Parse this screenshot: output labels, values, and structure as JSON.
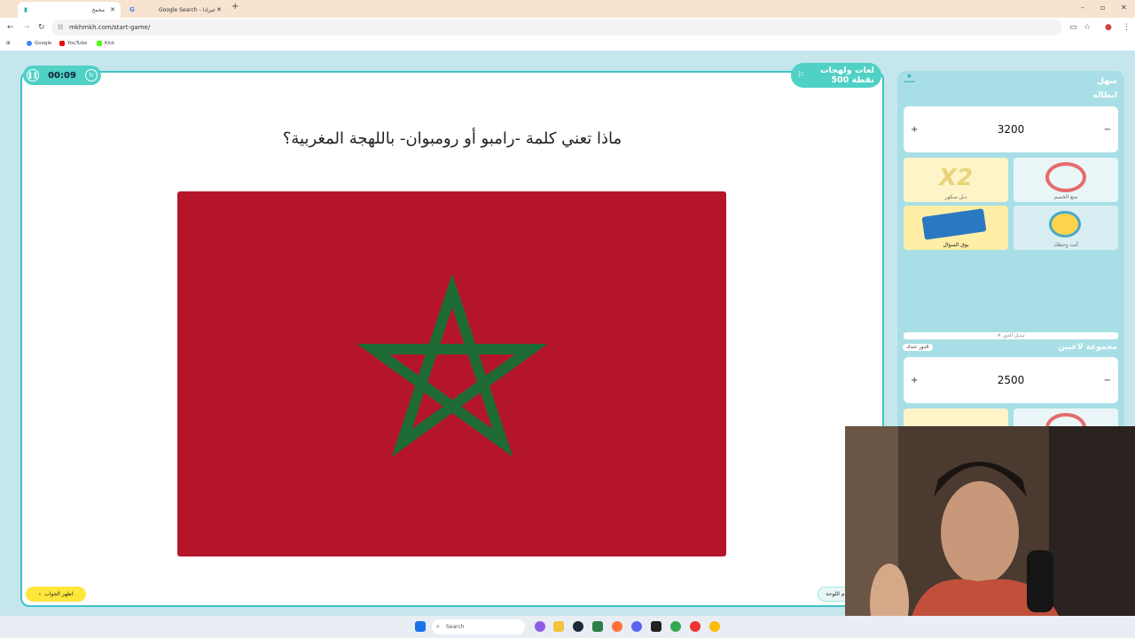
{
  "browser": {
    "tabs": [
      {
        "title": "مخمخ",
        "active": true
      },
      {
        "title": "Google Search - عيرادا",
        "active": false
      }
    ],
    "url": "mkhmkh.com/start-game/",
    "bookmarks": [
      "Google",
      "YouTube",
      "Kick"
    ]
  },
  "game": {
    "timer": "00:09",
    "category": {
      "name": "لغات ولهجات",
      "points": "500 نقطة"
    },
    "question": "ماذا تعني كلمة -رامبو أو رومبوان- باللهجة المغربية؟",
    "show_answer_label": "اظهر الجواب",
    "board_label": "م اللوحة",
    "image_colors": {
      "background": "#b5152b",
      "star": "#1f6b35"
    }
  },
  "sidebar": {
    "mini_label": "صفحة",
    "team1": {
      "label": "سهل",
      "name": "ابطاله",
      "score": "3200"
    },
    "powerups": [
      {
        "id": "x2",
        "text": "X2",
        "label": "دبل سكور"
      },
      {
        "id": "block",
        "label": "منع الخصم"
      },
      {
        "id": "cards",
        "label": "بوق السؤال"
      },
      {
        "id": "wheel",
        "label": "أنت وحظك"
      }
    ],
    "switch_turn": "تبديل الدور",
    "team2": {
      "name": "مجموعة لاعبين",
      "score": "2500",
      "turn_label": "الدور عندك"
    }
  },
  "taskbar": {
    "search_placeholder": "Search"
  }
}
